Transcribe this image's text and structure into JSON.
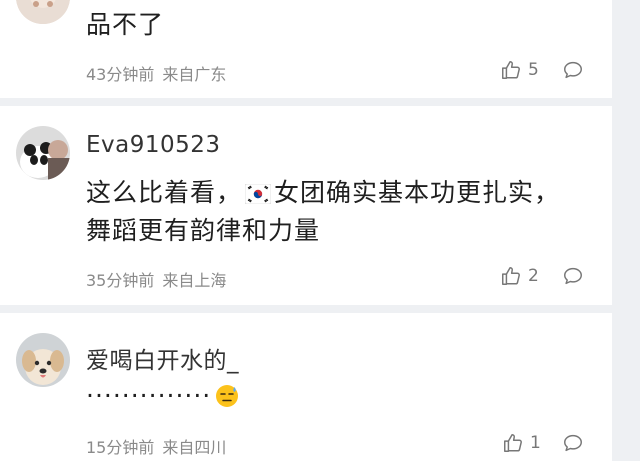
{
  "comments": [
    {
      "text": "品不了",
      "time": "43分钟前",
      "location": "来自广东",
      "likes": "5"
    },
    {
      "username": "Eva910523",
      "text_part1": "这么比着看，",
      "flag_icon": "south-korea-flag-icon",
      "text_part2": "女团确实基本功更扎实，",
      "text_line2": "舞蹈更有韵律和力量",
      "time": "35分钟前",
      "location": "来自上海",
      "likes": "2"
    },
    {
      "username": "爱喝白开水的_",
      "text": "··············",
      "emoji_icon": "cold-sweat-emoji-icon",
      "time": "15分钟前",
      "location": "来自四川",
      "likes": "1"
    }
  ],
  "colors": {
    "background": "#eef0f3",
    "card": "#ffffff",
    "meta_text": "#8a8a8a"
  }
}
